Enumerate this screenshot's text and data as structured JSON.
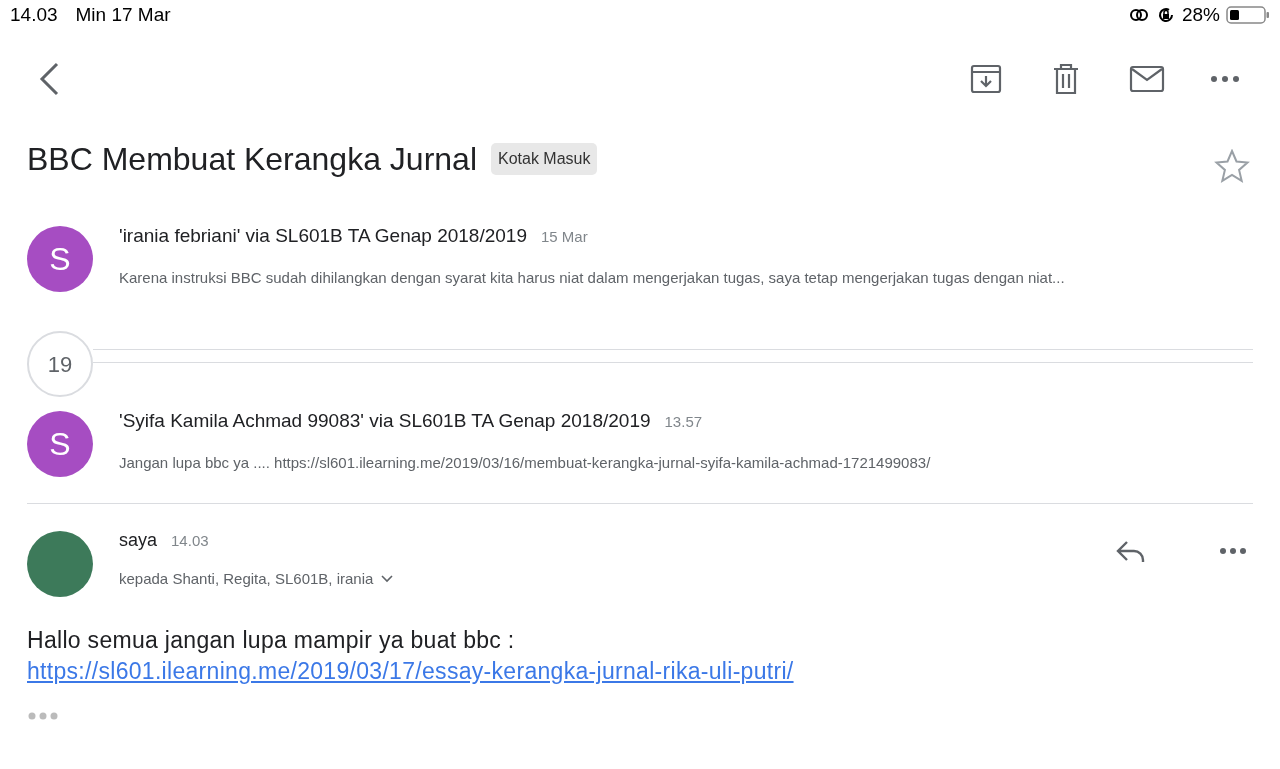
{
  "status_bar": {
    "time": "14.03",
    "date": "Min 17 Mar",
    "battery_text": "28%"
  },
  "subject": "BBC Membuat Kerangka Jurnal",
  "label": "Kotak Masuk",
  "starred": false,
  "thread": [
    {
      "kind": "message",
      "avatar_letter": "S",
      "color": "#a64dc2",
      "sender": "'irania febriani' via SL601B TA Genap 2018/2019",
      "time": "15 Mar",
      "snippet": "Karena instruksi BBC sudah dihilangkan dengan syarat kita harus niat dalam mengerjakan tugas, saya tetap mengerjakan tugas dengan niat..."
    },
    {
      "kind": "collapsed",
      "count": "19"
    },
    {
      "kind": "message",
      "avatar_letter": "S",
      "color": "#a64dc2",
      "sender": "'Syifa Kamila Achmad 99083' via SL601B TA Genap 2018/2019",
      "time": "13.57",
      "snippet": "Jangan lupa bbc ya .... https://sl601.ilearning.me/2019/03/16/membuat-kerangka-jurnal-syifa-kamila-achmad-1721499083/"
    },
    {
      "kind": "expanded",
      "sender": "saya",
      "time": "14.03",
      "recipients": "kepada Shanti, Regita, SL601B, irania",
      "body": "Hallo semua jangan lupa mampir ya buat bbc :",
      "link": "https://sl601.ilearning.me/2019/03/17/essay-kerangka-jurnal-rika-uli-putri/"
    }
  ]
}
